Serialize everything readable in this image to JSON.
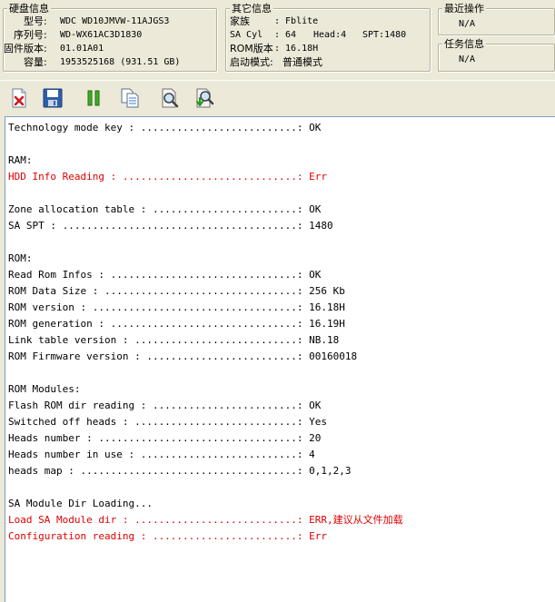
{
  "disk_info": {
    "title": "硬盘信息",
    "model_label": "型号:",
    "model": "WDC WD10JMVW-11AJGS3",
    "serial_label": "序列号:",
    "serial": "WD-WX61AC3D1830",
    "firmware_label": "固件版本:",
    "firmware": "01.01A01",
    "capacity_label": "容量:",
    "capacity": "1953525168 (931.51 GB)"
  },
  "other_info": {
    "title": "其它信息",
    "family_label": "家族",
    "family_value": ": Fblite",
    "sacyl_label": "SA Cyl",
    "sacyl_value": ": 64",
    "head_value": "Head:4",
    "spt_value": "SPT:1480",
    "romver_label": "ROM版本",
    "romver_value": ": 16.18H",
    "boot_label": "启动模式:",
    "boot_value": "普通模式"
  },
  "recent": {
    "title": "最近操作",
    "value": "N/A"
  },
  "task": {
    "title": "任务信息",
    "value": "N/A"
  },
  "toolbar": {
    "icons": [
      "doc-delete-icon",
      "save-icon",
      "pause-icon",
      "copy-icon",
      "search-icon",
      "search-download-icon"
    ]
  },
  "colors": {
    "error": "#e00000",
    "normal": "#000000"
  },
  "log": [
    {
      "text": "Technology mode key : ..........................: OK",
      "err": false
    },
    {
      "text": "",
      "err": false
    },
    {
      "text": "RAM:",
      "err": false
    },
    {
      "text": "HDD Info Reading : .............................: Err",
      "err": true
    },
    {
      "text": "",
      "err": false
    },
    {
      "text": "Zone allocation table : ........................: OK",
      "err": false
    },
    {
      "text": "SA SPT : .......................................: 1480",
      "err": false
    },
    {
      "text": "",
      "err": false
    },
    {
      "text": "ROM:",
      "err": false
    },
    {
      "text": "Read Rom Infos : ...............................: OK",
      "err": false
    },
    {
      "text": "ROM Data Size : ................................: 256 Kb",
      "err": false
    },
    {
      "text": "ROM version : ..................................: 16.18H",
      "err": false
    },
    {
      "text": "ROM generation : ...............................: 16.19H",
      "err": false
    },
    {
      "text": "Link table version : ...........................: NB.18",
      "err": false
    },
    {
      "text": "ROM Firmware version : .........................: 00160018",
      "err": false
    },
    {
      "text": "",
      "err": false
    },
    {
      "text": "ROM Modules:",
      "err": false
    },
    {
      "text": "Flash ROM dir reading : ........................: OK",
      "err": false
    },
    {
      "text": "Switched off heads : ...........................: Yes",
      "err": false
    },
    {
      "text": "Heads number : .................................: 20",
      "err": false
    },
    {
      "text": "Heads number in use : ..........................: 4",
      "err": false
    },
    {
      "text": "heads map : ....................................: 0,1,2,3",
      "err": false
    },
    {
      "text": "",
      "err": false
    },
    {
      "text": "SA Module Dir Loading...",
      "err": false
    },
    {
      "text": "Load SA Module dir : ...........................: ERR,建议从文件加载",
      "err": true
    },
    {
      "text": "Configuration reading : ........................: Err",
      "err": true
    }
  ]
}
